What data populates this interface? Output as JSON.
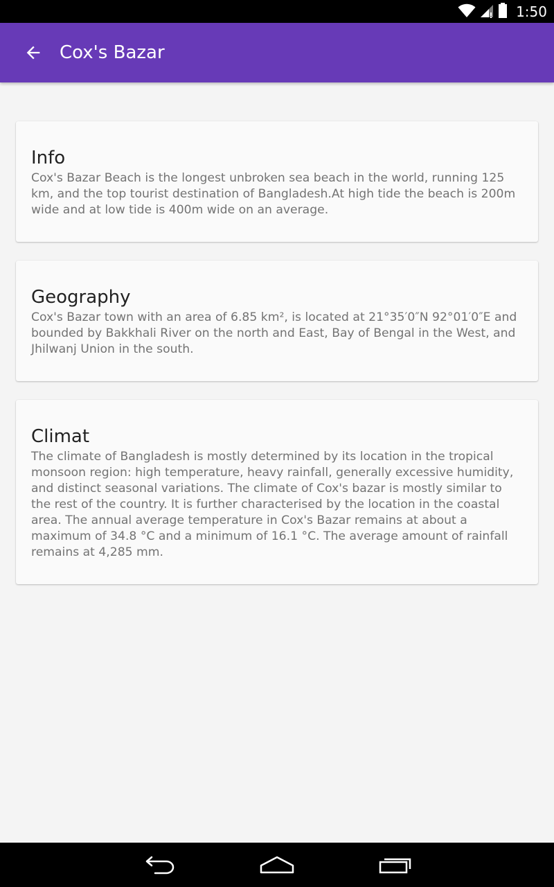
{
  "status_bar": {
    "time": "1:50",
    "icons": [
      "wifi-icon",
      "cell-signal-icon",
      "battery-icon"
    ]
  },
  "app_bar": {
    "title": "Cox's Bazar",
    "back_icon": "arrow-back-icon",
    "color": "#673ab7"
  },
  "sections": [
    {
      "title": "Info",
      "body": "Cox's Bazar Beach is the longest unbroken sea beach in the world, running 125 km, and the top tourist destination of Bangladesh.At high tide the beach is 200m wide and at low tide is 400m wide on an average."
    },
    {
      "title": "Geography",
      "body": "Cox's Bazar town with an area of 6.85 km², is located at 21°35′0″N 92°01′0″E and bounded by Bakkhali River on the north and East, Bay of Bengal in the West, and Jhilwanj Union in the south."
    },
    {
      "title": "Climat",
      "body": "The climate of Bangladesh is mostly determined by its location in the tropical monsoon region: high temperature, heavy rainfall, generally excessive humidity, and distinct seasonal variations. The climate of Cox's bazar is mostly similar to the rest of the country. It is further characterised by the location in the coastal area. The annual average temperature in Cox's Bazar remains at about a maximum of 34.8 °C and a minimum of 16.1 °C. The average amount of rainfall remains at 4,285 mm."
    }
  ],
  "nav_bar": {
    "icons": [
      "nav-back-icon",
      "nav-home-icon",
      "nav-recents-icon"
    ]
  }
}
